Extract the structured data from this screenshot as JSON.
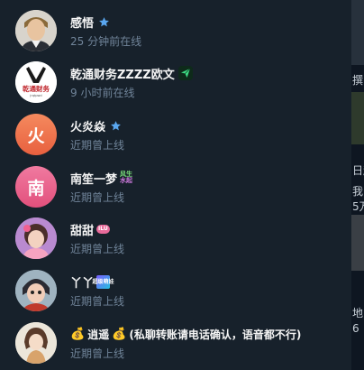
{
  "contacts": [
    {
      "name": "感悟",
      "status": "25 分钟前在线",
      "avatar_icon": "photo-avatar-man",
      "badge_icon": "star-icon"
    },
    {
      "name": "乾通财务ZZZZ欧文",
      "status": "9 小时前在线",
      "avatar_text": "乾通财务",
      "avatar_subtext": "jrqtpwd",
      "badge_icon": "send-icon"
    },
    {
      "name": "火炎焱",
      "status": "近期曾上线",
      "avatar_letter": "火",
      "badge_icon": "star-icon"
    },
    {
      "name": "南笙一梦",
      "status": "近期曾上线",
      "avatar_letter": "南",
      "badge_line1": "风生",
      "badge_line2": "水起"
    },
    {
      "name": "甜甜",
      "status": "近期曾上线",
      "avatar_icon": "photo-avatar-girl",
      "badge_pill": "ILU"
    },
    {
      "name": "丫丫",
      "status": "近期曾上线",
      "avatar_icon": "photo-avatar-toddler",
      "badge_square": "超级萌娃"
    },
    {
      "name": "逍遥",
      "name_suffix": "(私聊转账请电话确认，语音都不行)",
      "status": "近期曾上线",
      "avatar_icon": "photo-avatar-cartoon",
      "prefix_icon": "money-bag-icon"
    }
  ],
  "right_strip": {
    "text1": "撰",
    "text2": "日起",
    "text3": "我",
    "text4": "5万",
    "text5": "地",
    "text6": "6"
  },
  "colors": {
    "background": "#17212b",
    "name": "#f5f5f5",
    "status": "#708499",
    "star": "#5aa7f0",
    "orange_avatar": "#f07b4f",
    "pink_avatar": "#e85d8a"
  }
}
